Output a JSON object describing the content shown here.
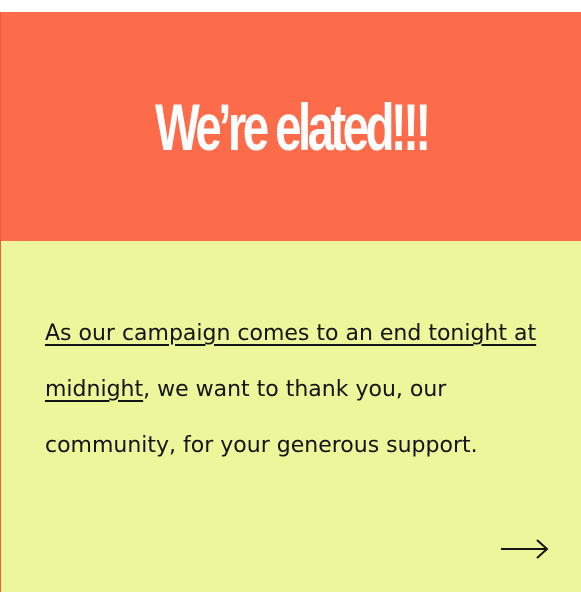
{
  "card": {
    "headline": "We’re elated!!!",
    "message_link": "As our campaign comes to an end tonight at midnight",
    "message_rest": ", we want to thank you, our community, for your generous support.",
    "next_icon": "arrow-right-icon"
  },
  "colors": {
    "header_bg": "#fd6c4a",
    "body_bg": "#eef69b",
    "headline_text": "#ffffff",
    "body_text": "#141414"
  }
}
